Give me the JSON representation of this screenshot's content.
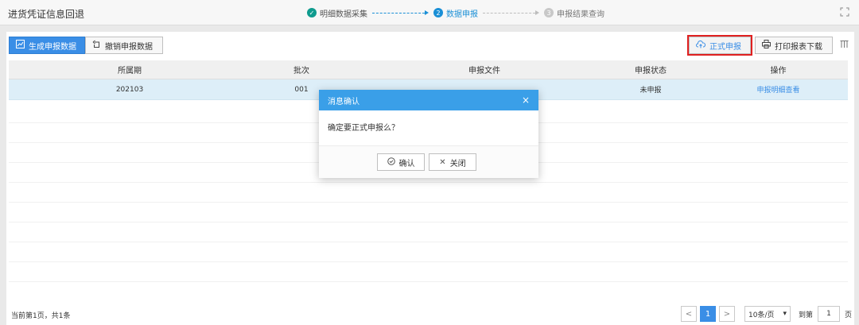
{
  "header": {
    "title": "进货凭证信息回退",
    "steps": [
      {
        "number": "✓",
        "label": "明细数据采集",
        "state": "done"
      },
      {
        "number": "2",
        "label": "数据申报",
        "state": "active"
      },
      {
        "number": "3",
        "label": "申报结果查询",
        "state": "todo"
      }
    ]
  },
  "toolbar": {
    "generate_label": "生成申报数据",
    "cancel_label": "撤销申报数据",
    "declare_label": "正式申报",
    "print_label": "打印报表下载"
  },
  "table": {
    "columns": [
      "所属期",
      "批次",
      "申报文件",
      "申报状态",
      "操作"
    ],
    "rows": [
      {
        "period": "202103",
        "batch": "001",
        "file": "",
        "status": "未申报",
        "action": "申报明细查看",
        "checked": true
      }
    ]
  },
  "footer": {
    "info": "当前第1页，共1条",
    "prev": "<",
    "current_page": "1",
    "next": ">",
    "page_size": "10条/页",
    "goto_label": "到第",
    "goto_value": "1",
    "page_unit": "页"
  },
  "modal": {
    "title": "消息确认",
    "message": "确定要正式申报么？",
    "confirm_label": "确认",
    "close_label": "关闭"
  },
  "colors": {
    "primary": "#3a8ee6",
    "done_step": "#0f9b8e",
    "highlight_outline": "#e02020",
    "modal_header": "#3a9fe8"
  }
}
